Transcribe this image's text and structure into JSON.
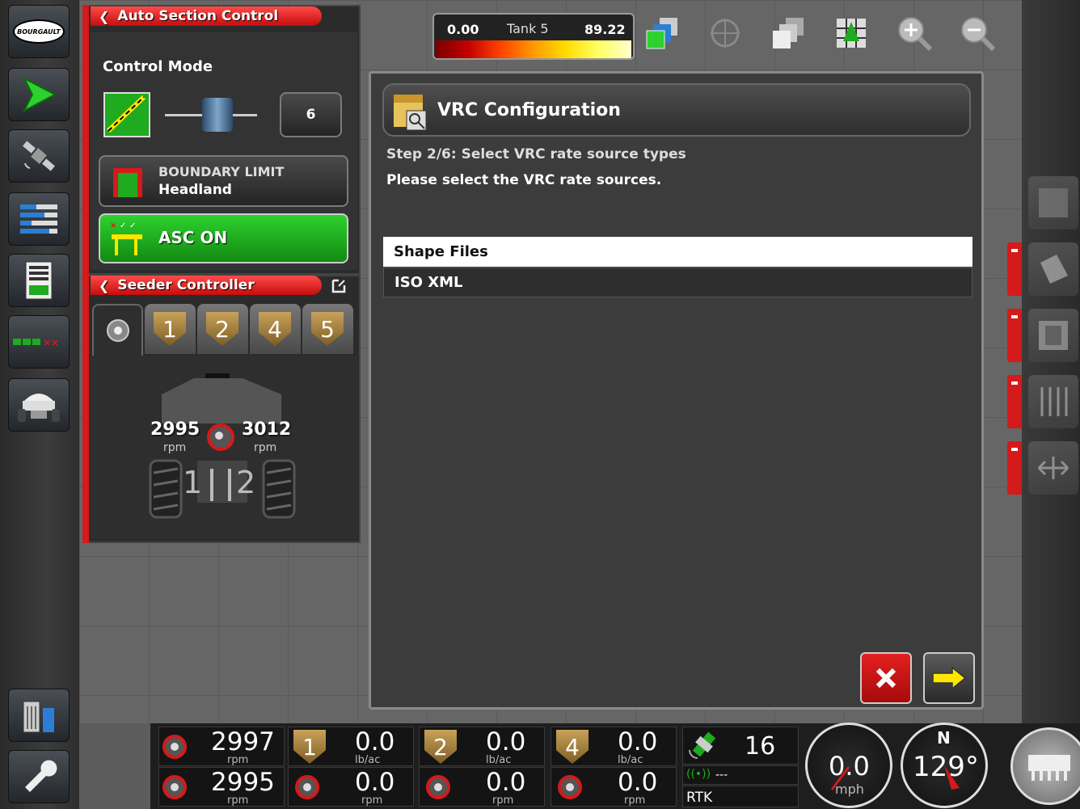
{
  "top_bar": {
    "gauge_min": "0.00",
    "gauge_label": "Tank 5",
    "gauge_max": "89.22",
    "icons": [
      "layers-icon",
      "target-icon",
      "layers-stack-icon",
      "field-grid-icon",
      "zoom-in-icon",
      "zoom-out-icon"
    ]
  },
  "left_sidebar": {
    "logo_text": "BOURGAULT",
    "items": [
      "logo",
      "guidance-icon",
      "gps-satellite-icon",
      "list-settings-icon",
      "calculator-icon",
      "section-status-icon",
      "tank-icon"
    ],
    "bottom_items": [
      "usb-trash-icon",
      "wrench-icon"
    ]
  },
  "asc_panel": {
    "title": "Auto Section Control",
    "control_mode_label": "Control Mode",
    "overlap_value": "6",
    "boundary_line1": "BOUNDARY LIMIT",
    "boundary_line2": "Headland",
    "asc_button": "ASC ON"
  },
  "seeder_panel": {
    "title": "Seeder Controller",
    "tabs": [
      "1",
      "2",
      "4",
      "5"
    ],
    "fan_left_rpm": "2995",
    "fan_right_rpm": "3012",
    "rpm_unit": "rpm",
    "meter_labels": [
      "1",
      "2"
    ]
  },
  "vrc_dialog": {
    "title": "VRC Configuration",
    "step": "Step 2/6: Select VRC rate source types",
    "instruction": "Please select the VRC rate sources.",
    "options": [
      "Shape Files",
      "ISO XML"
    ],
    "selected_index": 0
  },
  "status_bar": {
    "fan1_rpm": "2997",
    "fan2_rpm": "2995",
    "rpm_unit": "rpm",
    "tanks": [
      {
        "label": "1",
        "rate": "0.0",
        "rate_unit": "lb/ac",
        "rpm": "0.0"
      },
      {
        "label": "2",
        "rate": "0.0",
        "rate_unit": "lb/ac",
        "rpm": "0.0"
      },
      {
        "label": "4",
        "rate": "0.0",
        "rate_unit": "lb/ac",
        "rpm": "0.0"
      }
    ],
    "satellites": "16",
    "correction_value": "---",
    "gps_mode": "RTK",
    "speed": "0.0",
    "speed_unit": "mph",
    "heading": "129°",
    "compass_n": "N"
  },
  "colors": {
    "accent_red": "#d41a1a",
    "asc_green": "#1faa1f",
    "panel_dark": "#2b2b2b"
  }
}
